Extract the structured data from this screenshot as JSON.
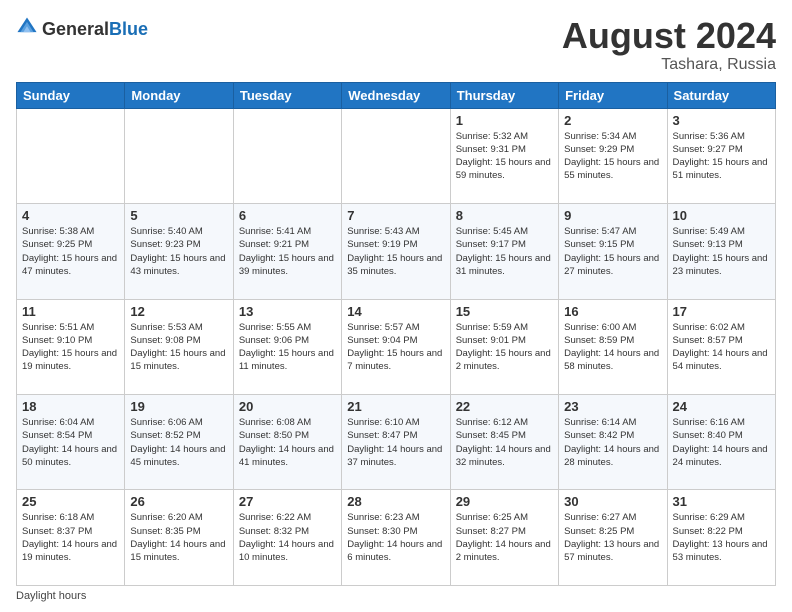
{
  "header": {
    "logo_general": "General",
    "logo_blue": "Blue",
    "title": "August 2024",
    "location": "Tashara, Russia"
  },
  "footer": {
    "daylight_label": "Daylight hours"
  },
  "days_of_week": [
    "Sunday",
    "Monday",
    "Tuesday",
    "Wednesday",
    "Thursday",
    "Friday",
    "Saturday"
  ],
  "weeks": [
    [
      {
        "day": "",
        "info": ""
      },
      {
        "day": "",
        "info": ""
      },
      {
        "day": "",
        "info": ""
      },
      {
        "day": "",
        "info": ""
      },
      {
        "day": "1",
        "info": "Sunrise: 5:32 AM\nSunset: 9:31 PM\nDaylight: 15 hours and 59 minutes."
      },
      {
        "day": "2",
        "info": "Sunrise: 5:34 AM\nSunset: 9:29 PM\nDaylight: 15 hours and 55 minutes."
      },
      {
        "day": "3",
        "info": "Sunrise: 5:36 AM\nSunset: 9:27 PM\nDaylight: 15 hours and 51 minutes."
      }
    ],
    [
      {
        "day": "4",
        "info": "Sunrise: 5:38 AM\nSunset: 9:25 PM\nDaylight: 15 hours and 47 minutes."
      },
      {
        "day": "5",
        "info": "Sunrise: 5:40 AM\nSunset: 9:23 PM\nDaylight: 15 hours and 43 minutes."
      },
      {
        "day": "6",
        "info": "Sunrise: 5:41 AM\nSunset: 9:21 PM\nDaylight: 15 hours and 39 minutes."
      },
      {
        "day": "7",
        "info": "Sunrise: 5:43 AM\nSunset: 9:19 PM\nDaylight: 15 hours and 35 minutes."
      },
      {
        "day": "8",
        "info": "Sunrise: 5:45 AM\nSunset: 9:17 PM\nDaylight: 15 hours and 31 minutes."
      },
      {
        "day": "9",
        "info": "Sunrise: 5:47 AM\nSunset: 9:15 PM\nDaylight: 15 hours and 27 minutes."
      },
      {
        "day": "10",
        "info": "Sunrise: 5:49 AM\nSunset: 9:13 PM\nDaylight: 15 hours and 23 minutes."
      }
    ],
    [
      {
        "day": "11",
        "info": "Sunrise: 5:51 AM\nSunset: 9:10 PM\nDaylight: 15 hours and 19 minutes."
      },
      {
        "day": "12",
        "info": "Sunrise: 5:53 AM\nSunset: 9:08 PM\nDaylight: 15 hours and 15 minutes."
      },
      {
        "day": "13",
        "info": "Sunrise: 5:55 AM\nSunset: 9:06 PM\nDaylight: 15 hours and 11 minutes."
      },
      {
        "day": "14",
        "info": "Sunrise: 5:57 AM\nSunset: 9:04 PM\nDaylight: 15 hours and 7 minutes."
      },
      {
        "day": "15",
        "info": "Sunrise: 5:59 AM\nSunset: 9:01 PM\nDaylight: 15 hours and 2 minutes."
      },
      {
        "day": "16",
        "info": "Sunrise: 6:00 AM\nSunset: 8:59 PM\nDaylight: 14 hours and 58 minutes."
      },
      {
        "day": "17",
        "info": "Sunrise: 6:02 AM\nSunset: 8:57 PM\nDaylight: 14 hours and 54 minutes."
      }
    ],
    [
      {
        "day": "18",
        "info": "Sunrise: 6:04 AM\nSunset: 8:54 PM\nDaylight: 14 hours and 50 minutes."
      },
      {
        "day": "19",
        "info": "Sunrise: 6:06 AM\nSunset: 8:52 PM\nDaylight: 14 hours and 45 minutes."
      },
      {
        "day": "20",
        "info": "Sunrise: 6:08 AM\nSunset: 8:50 PM\nDaylight: 14 hours and 41 minutes."
      },
      {
        "day": "21",
        "info": "Sunrise: 6:10 AM\nSunset: 8:47 PM\nDaylight: 14 hours and 37 minutes."
      },
      {
        "day": "22",
        "info": "Sunrise: 6:12 AM\nSunset: 8:45 PM\nDaylight: 14 hours and 32 minutes."
      },
      {
        "day": "23",
        "info": "Sunrise: 6:14 AM\nSunset: 8:42 PM\nDaylight: 14 hours and 28 minutes."
      },
      {
        "day": "24",
        "info": "Sunrise: 6:16 AM\nSunset: 8:40 PM\nDaylight: 14 hours and 24 minutes."
      }
    ],
    [
      {
        "day": "25",
        "info": "Sunrise: 6:18 AM\nSunset: 8:37 PM\nDaylight: 14 hours and 19 minutes."
      },
      {
        "day": "26",
        "info": "Sunrise: 6:20 AM\nSunset: 8:35 PM\nDaylight: 14 hours and 15 minutes."
      },
      {
        "day": "27",
        "info": "Sunrise: 6:22 AM\nSunset: 8:32 PM\nDaylight: 14 hours and 10 minutes."
      },
      {
        "day": "28",
        "info": "Sunrise: 6:23 AM\nSunset: 8:30 PM\nDaylight: 14 hours and 6 minutes."
      },
      {
        "day": "29",
        "info": "Sunrise: 6:25 AM\nSunset: 8:27 PM\nDaylight: 14 hours and 2 minutes."
      },
      {
        "day": "30",
        "info": "Sunrise: 6:27 AM\nSunset: 8:25 PM\nDaylight: 13 hours and 57 minutes."
      },
      {
        "day": "31",
        "info": "Sunrise: 6:29 AM\nSunset: 8:22 PM\nDaylight: 13 hours and 53 minutes."
      }
    ]
  ]
}
